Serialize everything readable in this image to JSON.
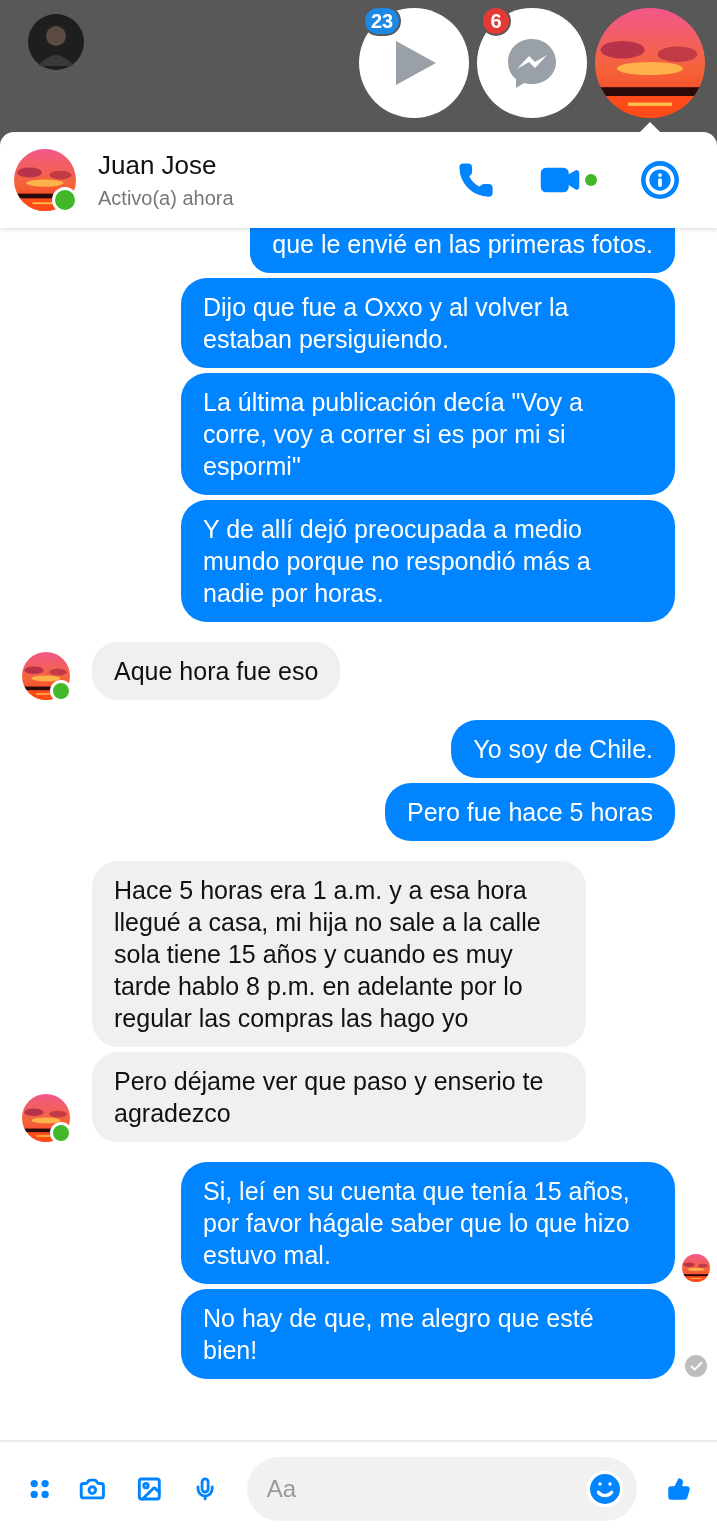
{
  "chat_heads": [
    {
      "kind": "video",
      "badge": "23",
      "color": "#1e88e5"
    },
    {
      "kind": "messenger",
      "badge": "6",
      "color": "#e53935"
    },
    {
      "kind": "contact",
      "selected": true
    }
  ],
  "header": {
    "name": "Juan Jose",
    "status": "Activo(a) ahora",
    "online": true,
    "video_active": true
  },
  "messages": [
    {
      "kind": "sent",
      "clipped": true,
      "text": "que le envié en las primeras fotos."
    },
    {
      "kind": "sent",
      "text": "Dijo que fue a Oxxo y al volver la estaban persiguiendo."
    },
    {
      "kind": "sent",
      "text": "La última publicación decía \"Voy a corre, voy a correr si es por mi si espormi\""
    },
    {
      "kind": "sent",
      "text": "Y de allí dejó preocupada a medio mundo porque no respondió más a nadie por horas."
    },
    {
      "kind": "received",
      "avatar": true,
      "text": "Aque hora fue eso"
    },
    {
      "kind": "sent",
      "text": "Yo soy de Chile."
    },
    {
      "kind": "sent",
      "text": "Pero fue hace 5 horas"
    },
    {
      "kind": "received",
      "avatar": false,
      "text": "Hace 5 horas era 1 a.m. y a esa hora llegué a casa, mi hija no sale a la calle sola tiene 15 años y cuando  es muy tarde hablo 8 p.m. en adelante por lo regular las compras las hago yo"
    },
    {
      "kind": "received",
      "avatar": true,
      "text": "Pero déjame ver que paso y enserio te agradezco"
    },
    {
      "kind": "sent",
      "seen": true,
      "text": "Si, leí en su cuenta que tenía 15 años, por favor hágale saber que lo que hizo estuvo mal."
    },
    {
      "kind": "sent",
      "delivered": true,
      "text": "No hay de que, me alegro que esté bien!"
    }
  ],
  "composer": {
    "placeholder": "Aa"
  }
}
